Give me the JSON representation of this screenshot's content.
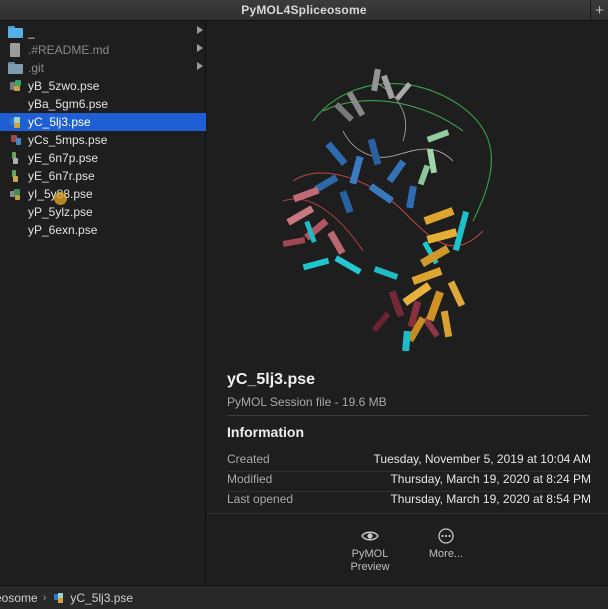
{
  "window": {
    "title": "PyMOL4Spliceosome",
    "add_tab_symbol": "+"
  },
  "sidebar": {
    "items": [
      {
        "label": "_",
        "kind": "folder",
        "has_children": true
      },
      {
        "label": ".#README.md",
        "kind": "document",
        "has_children": true,
        "dim": true
      },
      {
        "label": ".git",
        "kind": "folder-gray",
        "has_children": true,
        "dim": true
      },
      {
        "label": "yB_5zwo.pse",
        "kind": "pymol-session"
      },
      {
        "label": "yBa_5gm6.pse",
        "kind": "pymol-session"
      },
      {
        "label": "yC_5lj3.pse",
        "kind": "pymol-session",
        "selected": true
      },
      {
        "label": "yCs_5mps.pse",
        "kind": "pymol-session"
      },
      {
        "label": "yE_6n7p.pse",
        "kind": "pymol-session"
      },
      {
        "label": "yE_6n7r.pse",
        "kind": "pymol-session"
      },
      {
        "label": "yI_5y88.pse",
        "kind": "pymol-session"
      },
      {
        "label": "yP_5ylz.pse",
        "kind": "pymol-session"
      },
      {
        "label": "yP_6exn.pse",
        "kind": "pymol-session"
      }
    ]
  },
  "preview": {
    "file_name": "yC_5lj3.pse",
    "file_kind_size": "PyMOL Session file - 19.6 MB",
    "info_heading": "Information",
    "info": [
      {
        "key": "Created",
        "value": "Tuesday, November 5, 2019 at 10:04 AM"
      },
      {
        "key": "Modified",
        "value": "Thursday, March 19, 2020 at 8:24 PM"
      },
      {
        "key": "Last opened",
        "value": "Thursday, March 19, 2020 at 8:54 PM"
      }
    ],
    "actions": [
      {
        "label_line1": "PyMOL",
        "label_line2": "Preview",
        "icon": "eye-icon"
      },
      {
        "label_line1": "More...",
        "icon": "ellipsis-circle-icon"
      }
    ]
  },
  "pathbar": {
    "parent": "eosome",
    "separator": "›",
    "current": "yC_5lj3.pse"
  },
  "colors": {
    "selection": "#1f5fd4",
    "folder": "#58aee8",
    "background": "#1e1e1e"
  }
}
